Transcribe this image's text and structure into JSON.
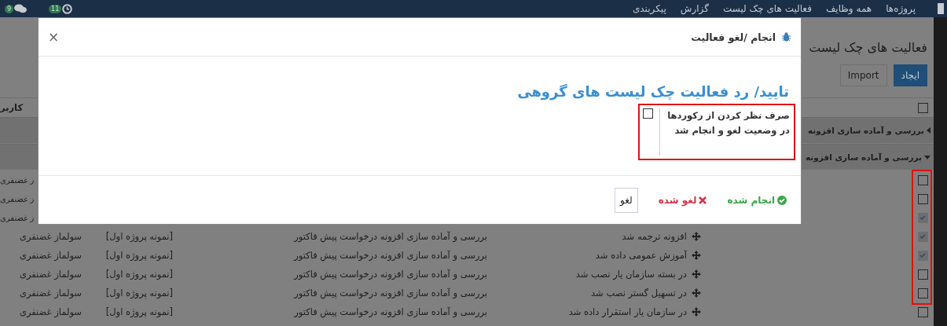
{
  "navbar": {
    "menu": [
      "پروژه‌ها",
      "همه وظایف",
      "فعالیت های چک لیست",
      "گزارش",
      "پیکربندی"
    ],
    "notifications": [
      {
        "kind": "activity",
        "count": "11"
      },
      {
        "kind": "messages",
        "count": "9"
      }
    ]
  },
  "page": {
    "title": "فعالیت های چک لیست",
    "buttons": [
      {
        "label": "ایجاد",
        "primary": true
      },
      {
        "label": "Import",
        "primary": false
      }
    ]
  },
  "table": {
    "columns": [
      {
        "label": "کاربر"
      }
    ],
    "select_all_checked": false,
    "groups": [
      {
        "label": "بررسی و آماده سازی افزونه",
        "expanded": false
      },
      {
        "label": "بررسی و آماده سازی افزونه",
        "expanded": true
      }
    ],
    "rows": [
      {
        "user": "ز غضنفری",
        "checked": false
      },
      {
        "user": "ز غضنفری",
        "checked": false
      },
      {
        "user": "ز غضنفری",
        "checked": true
      },
      {
        "name": "افزونه ترجمه شد",
        "parent": "بررسی و آماده سازی افزونه درخواست پیش فاکتور",
        "project": "[نمونه پروژه اول]",
        "user": "سولماز غضنفری",
        "checked": true
      },
      {
        "name": "آموزش عمومی داده شد",
        "parent": "بررسی و آماده سازی افزونه درخواست پیش فاکتور",
        "project": "[نمونه پروژه اول]",
        "user": "سولماز غضنفری",
        "checked": true
      },
      {
        "name": "در بسته سازمان یار نصب شد",
        "parent": "بررسی و آماده سازی افزونه درخواست پیش فاکتور",
        "project": "[نمونه پروژه اول]",
        "user": "سولماز غضنفری",
        "checked": false
      },
      {
        "name": "در تسهیل گستر نصب شد",
        "parent": "بررسی و آماده سازی افزونه درخواست پیش فاکتور",
        "project": "[نمونه پروژه اول]",
        "user": "سولماز غضنفری",
        "checked": false
      },
      {
        "name": "در سازمان یار استقرار داده شد",
        "parent": "بررسی و آماده سازی افزونه درخواست پیش فاکتور",
        "project": "[نمونه پروژه اول]",
        "user": "سولماز غضنفری",
        "checked": false
      }
    ]
  },
  "dialog": {
    "title": "انجام /لغو فعالیت",
    "close": "×",
    "heading": "تایید/ رد فعالیت چک لیست های گروهی",
    "option": {
      "label": "صرف نظر کردن از رکوردها در وضعیت لغو و انجام شد",
      "checked": false
    },
    "actions": [
      {
        "label": "انجام شده",
        "kind": "done"
      },
      {
        "label": "لغو شده",
        "kind": "cancelled"
      },
      {
        "label": "لغو",
        "kind": "close"
      }
    ]
  }
}
